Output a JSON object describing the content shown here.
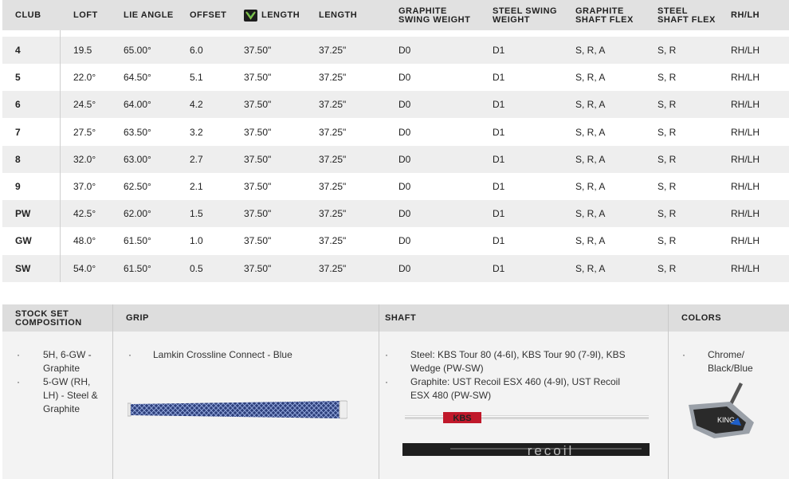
{
  "spec_table": {
    "headers": [
      "CLUB",
      "LOFT",
      "LIE ANGLE",
      "OFFSET",
      "LENGTH",
      "LENGTH",
      [
        "GRAPHITE",
        "SWING WEIGHT"
      ],
      [
        "STEEL SWING",
        "WEIGHT"
      ],
      [
        "GRAPHITE",
        "SHAFT FLEX"
      ],
      [
        "STEEL",
        "SHAFT FLEX"
      ],
      "RH/LH"
    ],
    "rows": [
      [
        "4",
        "19.5",
        "65.00°",
        "6.0",
        "37.50\"",
        "37.25\"",
        "D0",
        "D1",
        "S, R, A",
        "S, R",
        "RH/LH"
      ],
      [
        "5",
        "22.0°",
        "64.50°",
        "5.1",
        "37.50\"",
        "37.25\"",
        "D0",
        "D1",
        "S, R, A",
        "S, R",
        "RH/LH"
      ],
      [
        "6",
        "24.5°",
        "64.00°",
        "4.2",
        "37.50\"",
        "37.25\"",
        "D0",
        "D1",
        "S, R, A",
        "S, R",
        "RH/LH"
      ],
      [
        "7",
        "27.5°",
        "63.50°",
        "3.2",
        "37.50\"",
        "37.25\"",
        "D0",
        "D1",
        "S, R, A",
        "S, R",
        "RH/LH"
      ],
      [
        "8",
        "32.0°",
        "63.00°",
        "2.7",
        "37.50\"",
        "37.25\"",
        "D0",
        "D1",
        "S, R, A",
        "S, R",
        "RH/LH"
      ],
      [
        "9",
        "37.0°",
        "62.50°",
        "2.1",
        "37.50\"",
        "37.25\"",
        "D0",
        "D1",
        "S, R, A",
        "S, R",
        "RH/LH"
      ],
      [
        "PW",
        "42.5°",
        "62.00°",
        "1.5",
        "37.50\"",
        "37.25\"",
        "D0",
        "D1",
        "S, R, A",
        "S, R",
        "RH/LH"
      ],
      [
        "GW",
        "48.0°",
        "61.50°",
        "1.0",
        "37.50\"",
        "37.25\"",
        "D0",
        "D1",
        "S, R, A",
        "S, R",
        "RH/LH"
      ],
      [
        "SW",
        "54.0°",
        "61.50°",
        "0.5",
        "37.50\"",
        "37.25\"",
        "D0",
        "D1",
        "S, R, A",
        "S, R",
        "RH/LH"
      ]
    ]
  },
  "bottom": {
    "stock": {
      "title": [
        "STOCK SET",
        "COMPOSITION"
      ],
      "items": [
        [
          "5H, 6-GW -",
          "Graphite"
        ],
        [
          "5-GW (RH,",
          "LH) - Steel &",
          "Graphite"
        ]
      ]
    },
    "grip": {
      "title": "GRIP",
      "items": [
        [
          "Lamkin Crossline Connect - Blue"
        ]
      ]
    },
    "shaft": {
      "title": "SHAFT",
      "items": [
        [
          "Steel: KBS Tour 80 (4-6I), KBS Tour 90 (7-9I), KBS",
          "Wedge (PW-SW)"
        ],
        [
          "Graphite: UST Recoil ESX 460 (4-9I), UST Recoil",
          "ESX 480 (PW-SW)"
        ]
      ],
      "logo_kbs": "KBS",
      "logo_recoil": "recoil"
    },
    "colors": {
      "title": "COLORS",
      "items": [
        [
          "Chrome/",
          "Black/Blue"
        ]
      ],
      "club_text": "KING"
    }
  },
  "icons": {
    "length_header": "cobra-logo-icon",
    "bullet": "·"
  }
}
